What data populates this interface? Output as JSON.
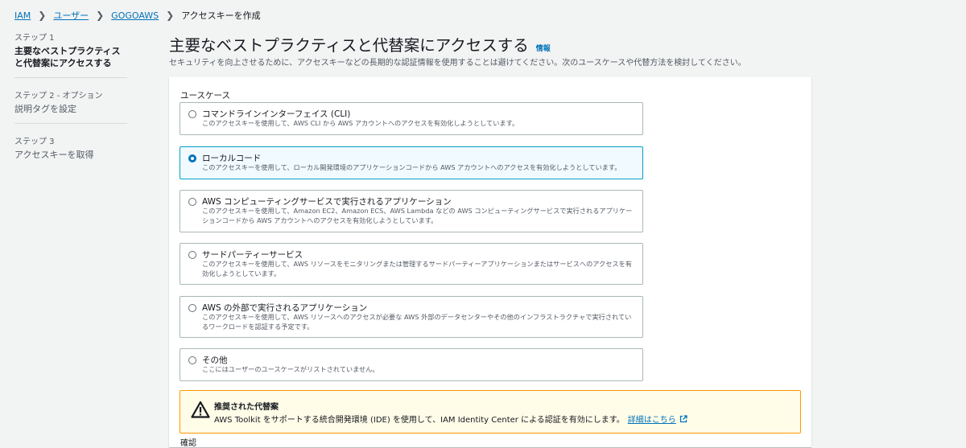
{
  "breadcrumb": {
    "items": [
      "IAM",
      "ユーザー",
      "GOGOAWS"
    ],
    "current": "アクセスキーを作成"
  },
  "steps": [
    {
      "num": "ステップ 1",
      "title": "主要なベストプラクティスと代替案にアクセスする"
    },
    {
      "num": "ステップ 2 - オプション",
      "title": "説明タグを設定"
    },
    {
      "num": "ステップ 3",
      "title": "アクセスキーを取得"
    }
  ],
  "header": {
    "title": "主要なベストプラクティスと代替案にアクセスする",
    "info": "情報",
    "subtitle": "セキュリティを向上させるために、アクセスキーなどの長期的な認証情報を使用することは避けてください。次のユースケースや代替方法を検討してください。"
  },
  "usecase": {
    "label": "ユースケース",
    "selected_index": 1,
    "options": [
      {
        "title": "コマンドラインインターフェイス (CLI)",
        "desc": "このアクセスキーを使用して、AWS CLI から AWS アカウントへのアクセスを有効化しようとしています。"
      },
      {
        "title": "ローカルコード",
        "desc": "このアクセスキーを使用して、ローカル開発環境のアプリケーションコードから AWS アカウントへのアクセスを有効化しようとしています。"
      },
      {
        "title": "AWS コンピューティングサービスで実行されるアプリケーション",
        "desc": "このアクセスキーを使用して、Amazon EC2、Amazon ECS、AWS Lambda などの AWS コンピューティングサービスで実行されるアプリケーションコードから AWS アカウントへのアクセスを有効化しようとしています。"
      },
      {
        "title": "サードパーティーサービス",
        "desc": "このアクセスキーを使用して、AWS リソースをモニタリングまたは管理するサードパーティーアプリケーションまたはサービスへのアクセスを有効化しようとしています。"
      },
      {
        "title": "AWS の外部で実行されるアプリケーション",
        "desc": "このアクセスキーを使用して、AWS リソースへのアクセスが必要な AWS 外部のデータセンターやその他のインフラストラクチャで実行されているワークロードを認証する予定です。"
      },
      {
        "title": "その他",
        "desc": "ここにはユーザーのユースケースがリストされていません。"
      }
    ]
  },
  "alert": {
    "title": "推奨された代替案",
    "body": "AWS Toolkit をサポートする統合開発環境 (IDE) を使用して、IAM Identity Center による認証を有効にします。",
    "link": "詳細はこちら"
  },
  "next_label": "確認"
}
